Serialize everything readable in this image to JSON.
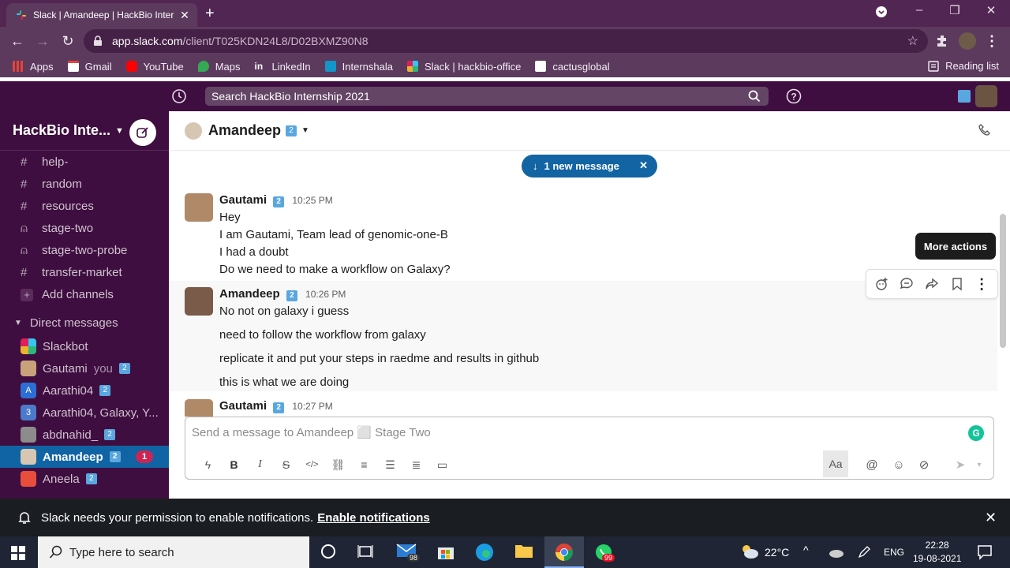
{
  "browser": {
    "tab_title": "Slack | Amandeep | HackBio Inter",
    "tab_close": "✕",
    "new_tab": "+",
    "url_host": "app.slack.com",
    "url_path": "/client/T025KDN24L8/D02BXMZ90N8",
    "bookmarks": [
      {
        "label": "Apps",
        "icon": "apps-grid-icon",
        "color": "#ea4335"
      },
      {
        "label": "Gmail",
        "icon": "gmail-icon",
        "color": "#ea4335"
      },
      {
        "label": "YouTube",
        "icon": "youtube-icon",
        "color": "#ff0000"
      },
      {
        "label": "Maps",
        "icon": "maps-icon",
        "color": "#34a853"
      },
      {
        "label": "LinkedIn",
        "icon": "linkedin-icon",
        "color": "#0a66c2"
      },
      {
        "label": "Internshala",
        "icon": "internshala-icon",
        "color": "#1295c9"
      },
      {
        "label": "Slack | hackbio-office",
        "icon": "slack-icon",
        "color": "#e01e5a"
      },
      {
        "label": "cactusglobal",
        "icon": "cactus-icon",
        "color": "#ffffff"
      }
    ],
    "reading_list": "Reading list"
  },
  "slack": {
    "search_placeholder": "Search HackBio Internship 2021",
    "workspace_name": "HackBio Inte...",
    "channels": [
      "help-",
      "random",
      "resources",
      "stage-two",
      "stage-two-probe",
      "transfer-market"
    ],
    "add_channels": "Add channels",
    "dm_header": "Direct messages",
    "dms": [
      {
        "name": "Slackbot",
        "suffix": "",
        "badge": false,
        "color": "#e01e5a"
      },
      {
        "name": "Gautami",
        "suffix": "you",
        "badge": true,
        "color": "#c9a27c"
      },
      {
        "name": "Aarathi04",
        "suffix": "",
        "badge": true,
        "color": "#2c6ed5"
      },
      {
        "name": "Aarathi04, Galaxy, Y...",
        "suffix": "",
        "badge": false,
        "color": "#4a7ac9"
      },
      {
        "name": "abdnahid_",
        "suffix": "",
        "badge": true,
        "color": "#8c8c8c"
      },
      {
        "name": "Amandeep",
        "suffix": "",
        "badge": true,
        "color": "#d6c6b2",
        "unread": "1",
        "active": true
      },
      {
        "name": "Aneela",
        "suffix": "",
        "badge": true,
        "color": "#e94e3c"
      }
    ],
    "channel_title": "Amandeep",
    "new_message_pill": "1 new message",
    "tooltip": "More actions",
    "messages": [
      {
        "author": "Gautami",
        "time": "10:25 PM",
        "lines": [
          "Hey",
          "I am Gautami, Team lead of genomic-one-B",
          "I had a doubt",
          "Do we need to make a workflow on Galaxy?"
        ]
      },
      {
        "author": "Amandeep",
        "time": "10:26 PM",
        "lines": [
          "No not on galaxy i guess",
          "need to follow the workflow from galaxy",
          "replicate it and put your steps in raedme and results in github",
          "this is what we are doing"
        ]
      },
      {
        "author": "Gautami",
        "time": "10:27 PM",
        "lines": []
      }
    ],
    "composer_placeholder": "Send a message to Amandeep ⬜ Stage Two",
    "aa_label": "Aa",
    "notification_text": "Slack needs your permission to enable notifications.",
    "notification_link": "Enable notifications"
  },
  "taskbar": {
    "search_placeholder": "Type here to search",
    "mail_count": "98",
    "whatsapp_count": "99",
    "weather": "22°C",
    "lang": "ENG",
    "time": "22:28",
    "date": "19-08-2021"
  }
}
